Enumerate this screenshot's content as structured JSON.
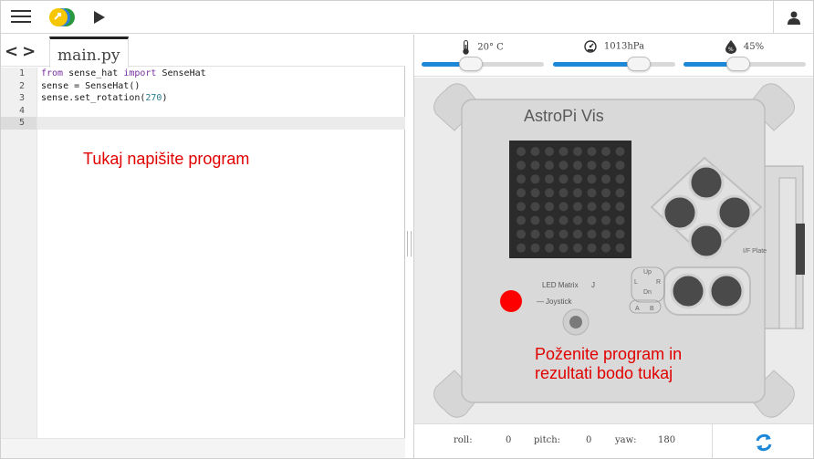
{
  "topbar": {
    "menu_icon": "hamburger-menu-icon",
    "logo_icon": "app-logo-icon",
    "run_icon": "play-icon",
    "user_icon": "user-icon"
  },
  "editor": {
    "back_forward_icon": "chevron-left-right-icon",
    "tab_label": "main.py",
    "line_numbers": [
      "1",
      "2",
      "3",
      "4",
      "5"
    ],
    "code_lines": [
      {
        "kw1": "from",
        "t1": " sense_hat ",
        "kw2": "import",
        "t2": " SenseHat"
      },
      {
        "text": "sense = SenseHat()"
      },
      {
        "pre": "sense.set_rotation(",
        "num": "270",
        "post": ")"
      },
      {
        "text": ""
      },
      {
        "text": ""
      }
    ],
    "hint": "Tukaj napišite program"
  },
  "emulator": {
    "sensors": [
      {
        "name": "temperature",
        "icon": "thermometer-icon",
        "label": "20° C",
        "level": 0.4
      },
      {
        "name": "pressure",
        "icon": "gauge-icon",
        "label": "1013hPa",
        "level": 0.7
      },
      {
        "name": "humidity",
        "icon": "humidity-drop-icon",
        "label": "45%",
        "level": 0.45
      }
    ],
    "board": {
      "title": "AstroPi Vis",
      "led_matrix_label": "LED Matrix",
      "joystick_label": "Joystick",
      "if_plate_label": "I/F Plate",
      "dpad_labels": [
        "Up",
        "L",
        "R",
        "Dn",
        "A",
        "B"
      ],
      "led_rows": 8,
      "led_cols": 8
    },
    "hint_line1": "Poženite program in",
    "hint_line2": "rezultati bodo tukaj",
    "imu": {
      "roll_label": "roll:",
      "roll_value": "0",
      "pitch_label": "pitch:",
      "pitch_value": "0",
      "yaw_label": "yaw:",
      "yaw_value": "180"
    },
    "refresh_icon": "refresh-icon"
  },
  "colors": {
    "accent": "#1e88d8",
    "hint_red": "#e10000",
    "led_off": "#454545",
    "matrix_bg": "#2b2b2b",
    "status_led": "#ff0000"
  }
}
